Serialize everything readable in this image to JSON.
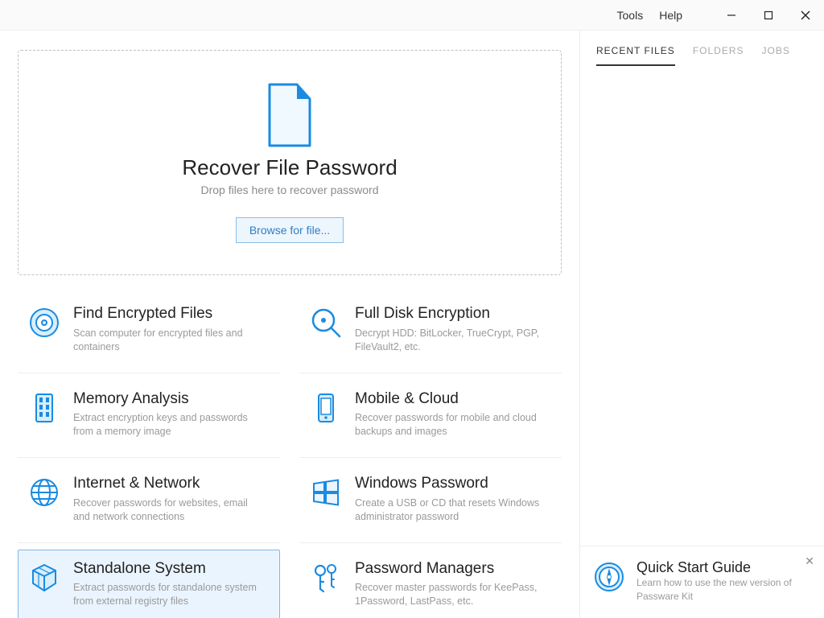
{
  "titlebar": {
    "menu_tools": "Tools",
    "menu_help": "Help"
  },
  "dropzone": {
    "title": "Recover File Password",
    "subtitle": "Drop files here to recover password",
    "browse_label": "Browse for file..."
  },
  "cards": [
    {
      "title": "Find Encrypted Files",
      "desc": "Scan computer for encrypted files and containers"
    },
    {
      "title": "Full Disk Encryption",
      "desc": "Decrypt HDD: BitLocker, TrueCrypt, PGP, FileVault2, etc."
    },
    {
      "title": "Memory Analysis",
      "desc": "Extract encryption keys and passwords from a memory image"
    },
    {
      "title": "Mobile & Cloud",
      "desc": "Recover passwords for mobile and cloud backups and images"
    },
    {
      "title": "Internet & Network",
      "desc": "Recover passwords for websites, email and network connections"
    },
    {
      "title": "Windows Password",
      "desc": "Create a USB or CD that resets Windows administrator password"
    },
    {
      "title": "Standalone System",
      "desc": "Extract passwords for standalone system from external registry files"
    },
    {
      "title": "Password Managers",
      "desc": "Recover master passwords for KeePass, 1Password, LastPass, etc."
    }
  ],
  "side": {
    "tab_recent": "RECENT FILES",
    "tab_folders": "FOLDERS",
    "tab_jobs": "JOBS"
  },
  "qsg": {
    "title": "Quick Start Guide",
    "desc": "Learn how to use the new version of Passware Kit"
  }
}
